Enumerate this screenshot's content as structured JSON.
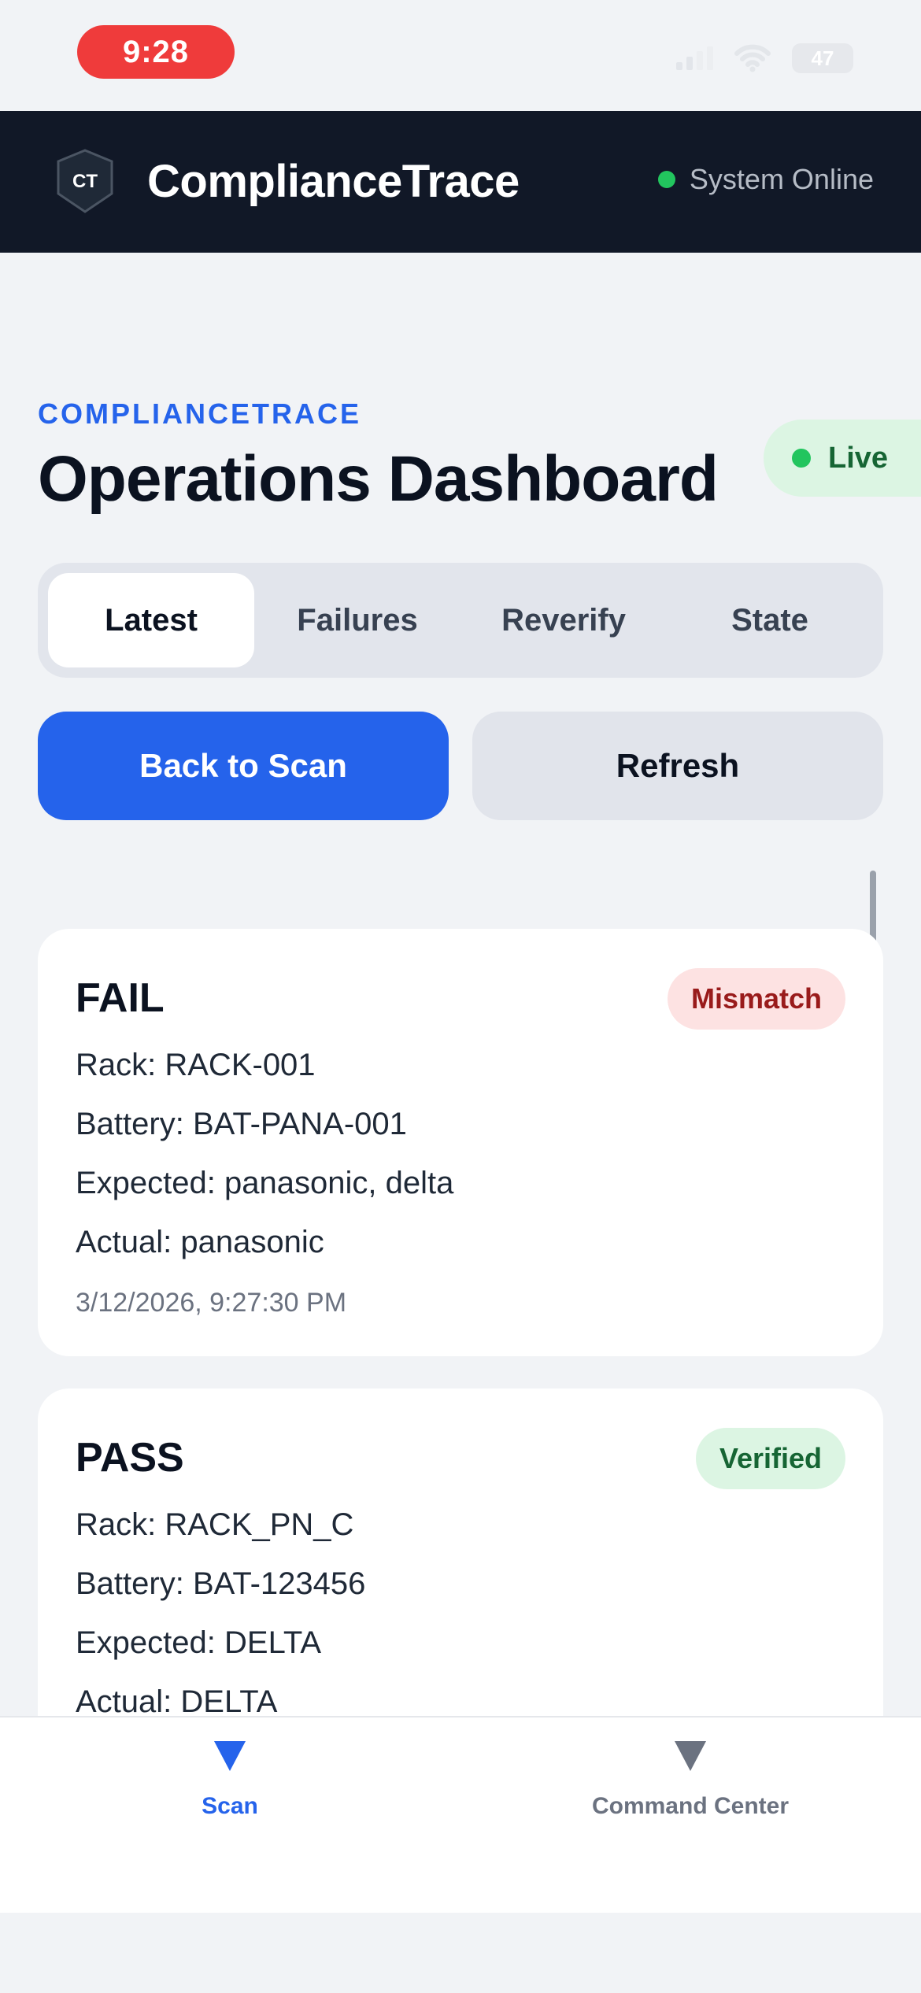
{
  "status_bar": {
    "time": "9:28",
    "battery": "47"
  },
  "header": {
    "logo_text": "CT",
    "app_name": "ComplianceTrace",
    "system_status": "System Online"
  },
  "page": {
    "eyebrow": "COMPLIANCETRACE",
    "title": "Operations Dashboard",
    "live_label": "Live"
  },
  "tabs": [
    {
      "label": "Latest",
      "active": true
    },
    {
      "label": "Failures",
      "active": false
    },
    {
      "label": "Reverify",
      "active": false
    },
    {
      "label": "State",
      "active": false
    }
  ],
  "actions": {
    "primary": "Back to Scan",
    "secondary": "Refresh"
  },
  "records": [
    {
      "status": "FAIL",
      "badge": "Mismatch",
      "rack": "Rack: RACK-001",
      "battery": "Battery: BAT-PANA-001",
      "expected": "Expected: panasonic, delta",
      "actual": "Actual: panasonic",
      "timestamp": "3/12/2026, 9:27:30 PM"
    },
    {
      "status": "PASS",
      "badge": "Verified",
      "rack": "Rack: RACK_PN_C",
      "battery": "Battery: BAT-123456",
      "expected": "Expected: DELTA",
      "actual": "Actual: DELTA"
    }
  ],
  "bottom_nav": [
    {
      "label": "Scan",
      "icon": "scan-icon",
      "active": true
    },
    {
      "label": "Command Center",
      "icon": "command-center-icon",
      "active": false
    }
  ],
  "colors": {
    "accent": "#2563eb",
    "header_bg": "#111827",
    "fail": "#991b1b",
    "pass": "#166534",
    "online": "#22c55e",
    "time_pill": "#ef3b3b"
  }
}
